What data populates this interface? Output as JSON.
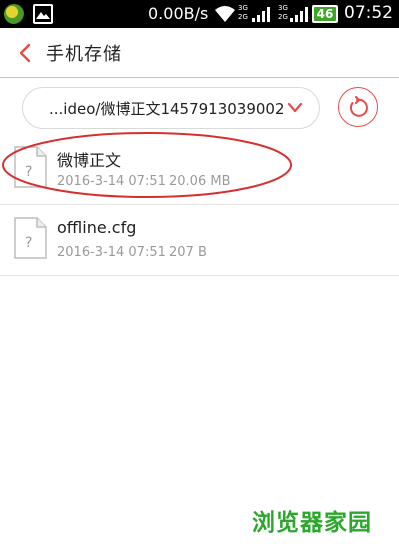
{
  "status_bar": {
    "speed": "0.00B/s",
    "net1": "3G\n2G",
    "net2": "3G\n2G",
    "battery": "46",
    "time": "07:52"
  },
  "header": {
    "title": "手机存储"
  },
  "path_bar": {
    "path": "...ideo/微博正文1457913039002"
  },
  "files": [
    {
      "name": "微博正文",
      "date": "2016-3-14 07:51",
      "size": "20.06 MB"
    },
    {
      "name": "offline.cfg",
      "date": "2016-3-14 07:51",
      "size": "207 B"
    }
  ],
  "watermark": "浏览器家园",
  "colors": {
    "accent": "#e74b4b",
    "watermark": "#2ba82b",
    "annotation": "#d63030"
  }
}
